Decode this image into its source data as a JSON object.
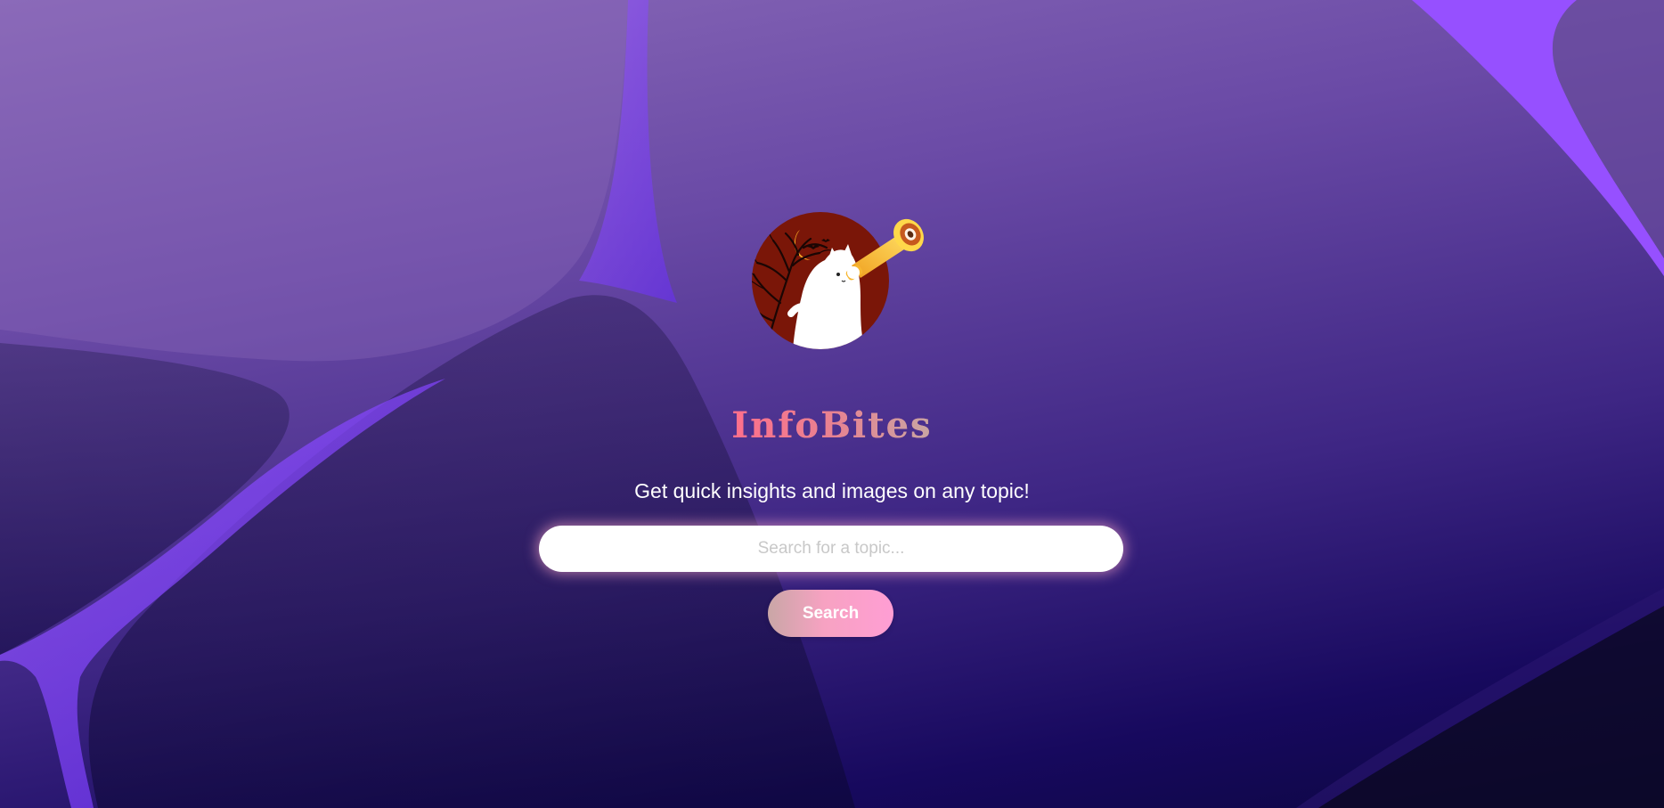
{
  "app": {
    "title": "InfoBites",
    "tagline": "Get quick insights and images on any topic!"
  },
  "logo": {
    "icon": "ghost-telescope-logo-icon",
    "description_colors": {
      "circle": "#7a1608",
      "ghost": "#ffffff",
      "telescope": "#f5c23a"
    }
  },
  "search": {
    "placeholder": "Search for a topic...",
    "value": "",
    "button_label": "Search"
  },
  "colors": {
    "background_top": "#8a6ab8",
    "background_bottom": "#0c0640",
    "accent_purple": "#8a4dff",
    "title_gradient_start": "#ff6f8c",
    "title_gradient_end": "#c9a4a2",
    "button_gradient_start": "#c9a6a6",
    "button_gradient_end": "#ff9ed4"
  }
}
